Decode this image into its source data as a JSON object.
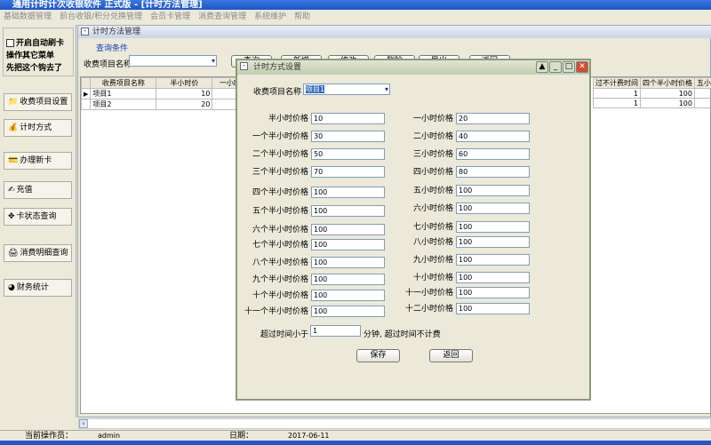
{
  "app": {
    "title": "通用计时计次收银软件    正式版  - [计时方法管理]"
  },
  "menu": [
    "基础数据管理",
    "前台收银/积分兑换管理",
    "会员卡管理",
    "消费查询管理",
    "系统维护",
    "帮助"
  ],
  "left": {
    "auto_card": "开启自动刷卡",
    "note1": "操作其它菜单",
    "note2": "先把这个钩去了",
    "items": [
      {
        "label": "收费项目设置",
        "icon": "folder-settings-icon",
        "glyph": "📁"
      },
      {
        "label": "计时方式",
        "icon": "money-bag-icon",
        "glyph": "💰"
      },
      {
        "label": "办理新卡",
        "icon": "new-card-icon",
        "glyph": "💳"
      },
      {
        "label": "充值",
        "icon": "pen-paper-icon",
        "glyph": "✍"
      },
      {
        "label": "卡状态查询",
        "icon": "card-status-icon",
        "glyph": "✥"
      },
      {
        "label": "消费明细查询",
        "icon": "printer-icon",
        "glyph": "🖨"
      },
      {
        "label": "财务统计",
        "icon": "chart-icon",
        "glyph": "◕"
      }
    ]
  },
  "main": {
    "title": "计时方法管理",
    "query_group": "查询条件",
    "query_label": "收费项目名称",
    "query_value": "",
    "buttons": [
      "查询",
      "新增",
      "修改",
      "删除",
      "导出",
      "返回"
    ],
    "grid": {
      "headers_left": [
        "收费项目名称",
        "半小时价",
        "一小时"
      ],
      "headers_right": [
        "过不计费时间",
        "四个半小时价格",
        "五小"
      ],
      "rows": [
        {
          "name": "项目1",
          "half": "10",
          "free": "1",
          "p45": "100"
        },
        {
          "name": "项目2",
          "half": "20",
          "free": "1",
          "p45": "100"
        }
      ]
    }
  },
  "dialog": {
    "title": "计时方式设置",
    "item_label": "收费项目名称",
    "item_value": "项目1",
    "left_fields": [
      [
        "半小时价格",
        "10"
      ],
      [
        "一个半小时价格",
        "30"
      ],
      [
        "二个半小时价格",
        "50"
      ],
      [
        "三个半小时价格",
        "70"
      ],
      [
        "四个半小时价格",
        "100"
      ],
      [
        "五个半小时价格",
        "100"
      ],
      [
        "六个半小时价格",
        "100"
      ],
      [
        "七个半小时价格",
        "100"
      ],
      [
        "八个半小时价格",
        "100"
      ],
      [
        "九个半小时价格",
        "100"
      ],
      [
        "十个半小时价格",
        "100"
      ],
      [
        "十一个半小时价格",
        "100"
      ]
    ],
    "right_fields": [
      [
        "一小时价格",
        "20"
      ],
      [
        "二小时价格",
        "40"
      ],
      [
        "三小时价格",
        "60"
      ],
      [
        "四小时价格",
        "80"
      ],
      [
        "五小时价格",
        "100"
      ],
      [
        "六小时价格",
        "100"
      ],
      [
        "七小时价格",
        "100"
      ],
      [
        "八小时价格",
        "100"
      ],
      [
        "九小时价格",
        "100"
      ],
      [
        "十小时价格",
        "100"
      ],
      [
        "十一小时价格",
        "100"
      ],
      [
        "十二小时价格",
        "100"
      ]
    ],
    "over_label": "超过时间小于",
    "over_value": "1",
    "over_suffix": "分钟, 超过时间不计费",
    "save": "保存",
    "back": "返回"
  },
  "status": {
    "operator_label": "当前操作员：",
    "operator": "admin",
    "date_label": "日期：",
    "date": "2017-06-11"
  }
}
